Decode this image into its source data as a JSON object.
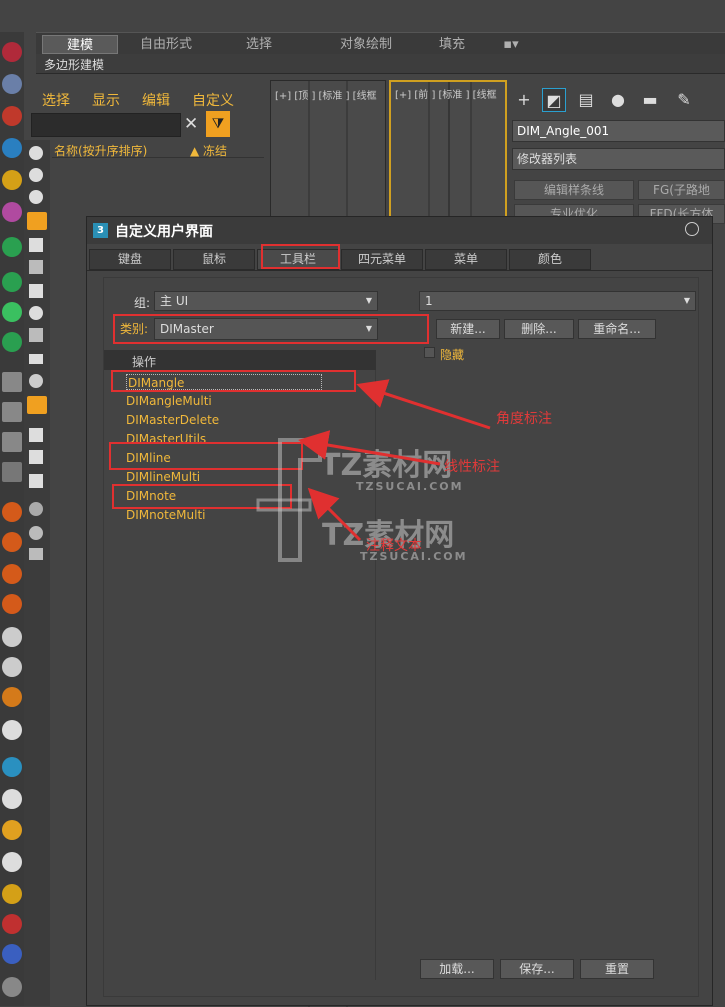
{
  "ribbon": {
    "tabs": [
      "建模",
      "自由形式",
      "选择",
      "对象绘制",
      "填充"
    ],
    "sub_label": "多边形建模"
  },
  "explorer": {
    "menu": [
      "选择",
      "显示",
      "编辑",
      "自定义"
    ],
    "header_name": "名称(按升序排序)",
    "header_freeze": "▲ 冻结"
  },
  "viewports": {
    "left_label": "[+] [顶 ] [标准 ] [线框",
    "right_label": "[+] [前 ] [标准 ] [线框"
  },
  "command_panel": {
    "object_name": "DIM_Angle_001",
    "modifier_list": "修改器列表",
    "buttons": [
      "编辑样条线",
      "FG(子路地",
      "专业优化",
      "FFD(长方体"
    ]
  },
  "dialog": {
    "title": "自定义用户界面",
    "icon_label": "3",
    "tabs": [
      "键盘",
      "鼠标",
      "工具栏",
      "四元菜单",
      "菜单",
      "颜色"
    ],
    "group_label": "组:",
    "group_value": "主 UI",
    "category_label": "类别:",
    "category_value": "DIMaster",
    "toolbar_value": "1",
    "buttons": {
      "new": "新建...",
      "delete": "删除...",
      "rename": "重命名..."
    },
    "hide_label": "隐藏",
    "actions_header": "操作",
    "actions": [
      "DIMangle",
      "DIMangleMulti",
      "DIMasterDelete",
      "DIMasterUtils",
      "DIMline",
      "DIMlineMulti",
      "DIMnote",
      "DIMnoteMulti"
    ],
    "bottom_buttons": {
      "load": "加载...",
      "save": "保存...",
      "reset": "重置"
    }
  },
  "annotations": {
    "angle": "角度标注",
    "linear": "线性标注",
    "note": "注释文本"
  },
  "watermark": {
    "text": "TZ素材网",
    "sub": "TZSUCAI.COM"
  },
  "colors": {
    "accent": "#f0b83b",
    "highlight_red": "#e03030",
    "background": "#444444"
  }
}
